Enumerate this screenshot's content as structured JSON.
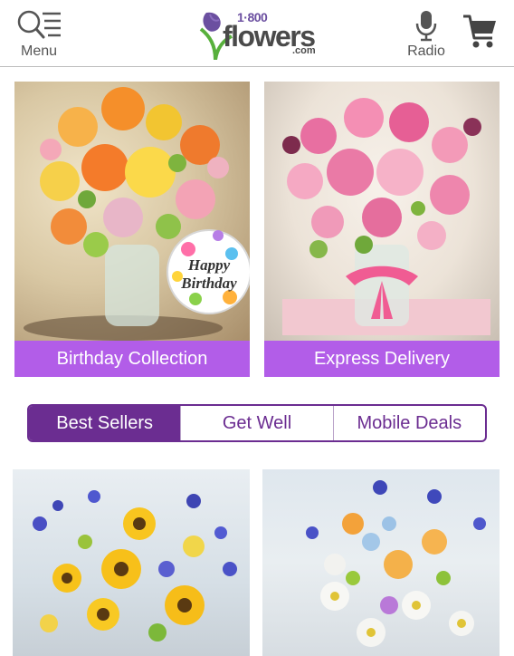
{
  "header": {
    "menu_label": "Menu",
    "radio_label": "Radio",
    "logo": {
      "number": "1·800",
      "word": "flowers",
      "suffix": ".com"
    }
  },
  "colors": {
    "brand_purple": "#6b2d91",
    "caption_purple": "#b25de8",
    "logo_green": "#58b03c"
  },
  "featured": [
    {
      "caption": "Birthday Collection"
    },
    {
      "caption": "Express Delivery"
    }
  ],
  "balloon": {
    "line1": "Happy",
    "line2": "Birthday"
  },
  "tabs": [
    "Best Sellers",
    "Get Well",
    "Mobile Deals"
  ],
  "active_tab": "Best Sellers",
  "icons": {
    "menu": "search-menu-icon",
    "radio": "microphone-icon",
    "cart": "cart-icon"
  }
}
